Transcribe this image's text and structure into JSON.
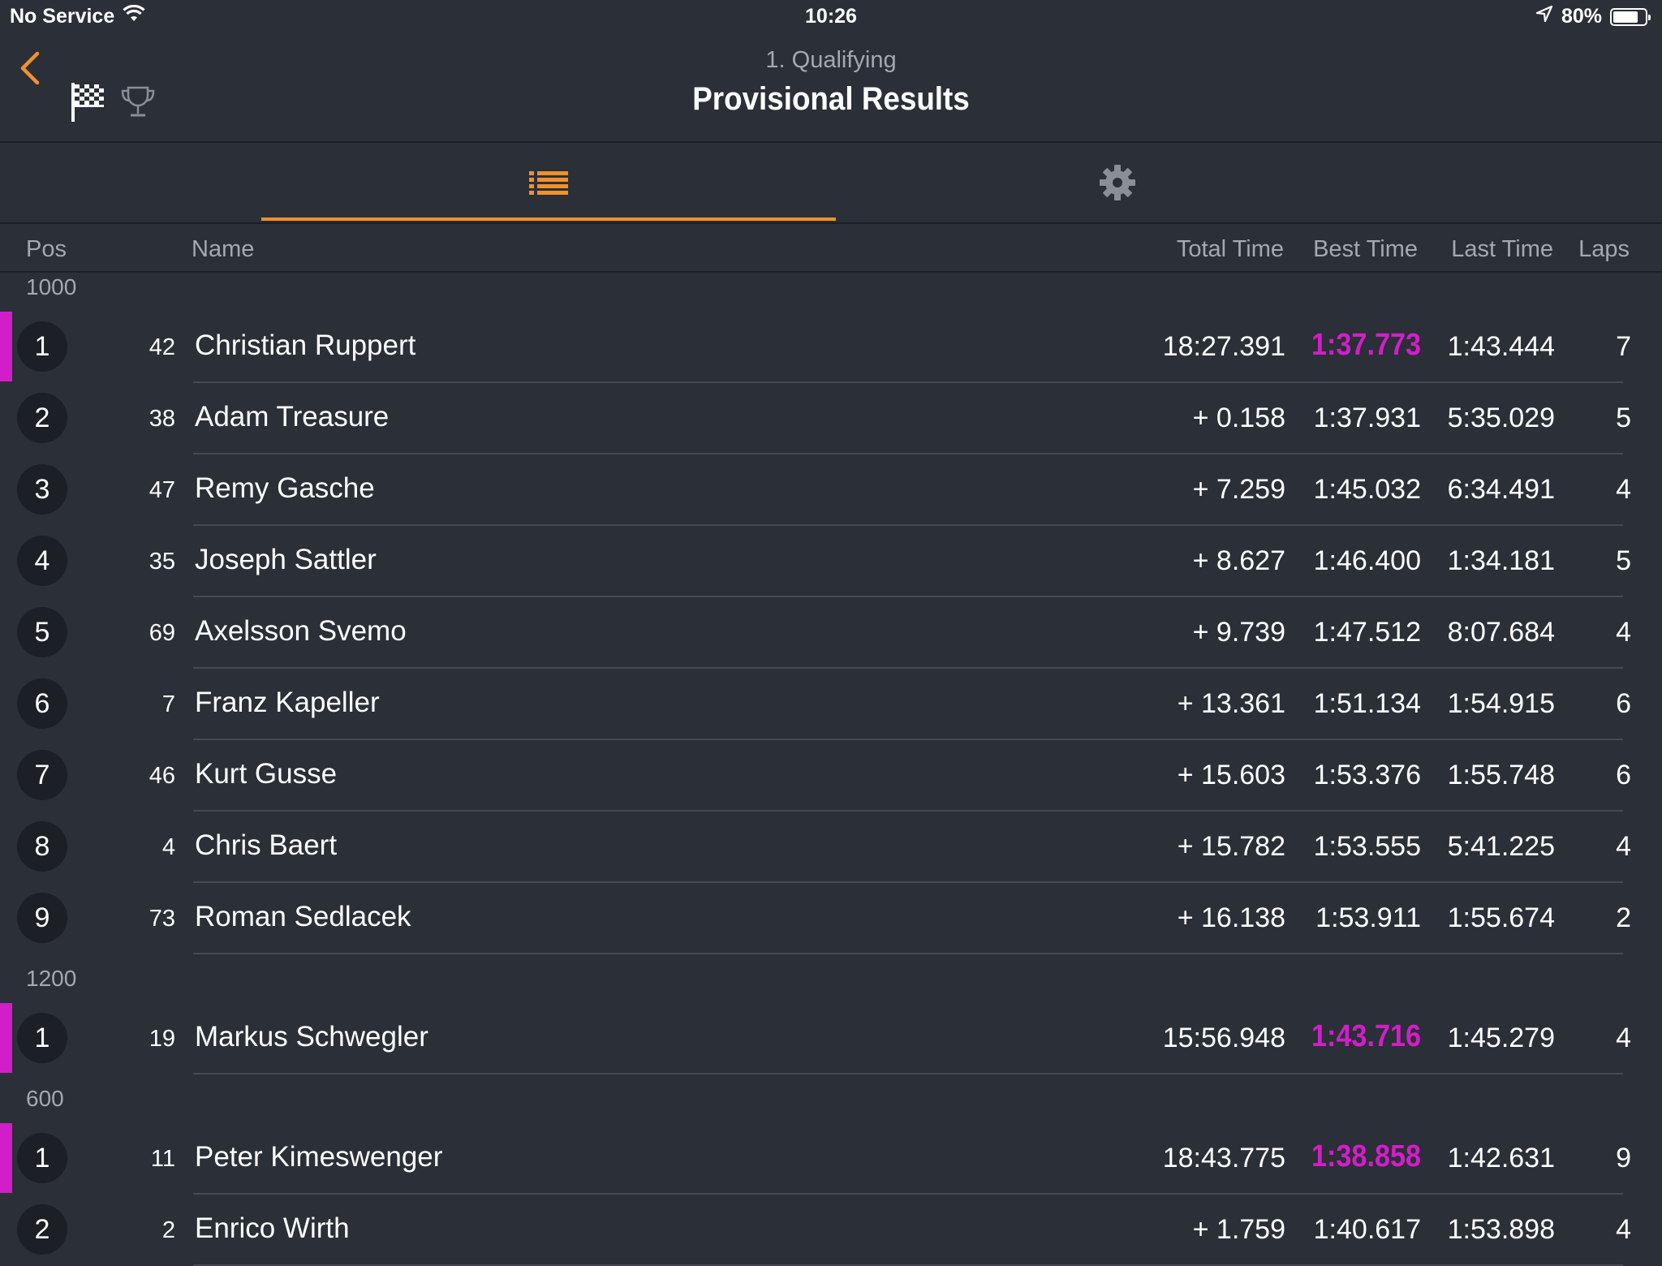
{
  "status_bar": {
    "carrier": "No Service",
    "time": "10:26",
    "battery": "80%",
    "battery_level": 0.8
  },
  "nav": {
    "subtitle": "1. Qualifying",
    "title": "Provisional Results"
  },
  "tabs": [
    {
      "icon": "list-icon",
      "selected": true
    },
    {
      "icon": "gear-icon",
      "selected": false
    }
  ],
  "columns": {
    "pos": "Pos",
    "name": "Name",
    "total": "Total Time",
    "best": "Best Time",
    "last": "Last Time",
    "laps": "Laps"
  },
  "colors": {
    "accent": "#f0912a",
    "fastest": "#d21ec9",
    "background": "#2b2f38"
  },
  "groups": [
    {
      "label": "1000",
      "rows": [
        {
          "pos": "1",
          "num": "42",
          "name": "Christian Ruppert",
          "total": "18:27.391",
          "best": "1:37.773",
          "last": "1:43.444",
          "laps": "7",
          "fastest": true
        },
        {
          "pos": "2",
          "num": "38",
          "name": "Adam Treasure",
          "total": "+ 0.158",
          "best": "1:37.931",
          "last": "5:35.029",
          "laps": "5"
        },
        {
          "pos": "3",
          "num": "47",
          "name": "Remy Gasche",
          "total": "+ 7.259",
          "best": "1:45.032",
          "last": "6:34.491",
          "laps": "4"
        },
        {
          "pos": "4",
          "num": "35",
          "name": "Joseph Sattler",
          "total": "+ 8.627",
          "best": "1:46.400",
          "last": "1:34.181",
          "laps": "5"
        },
        {
          "pos": "5",
          "num": "69",
          "name": "Axelsson Svemo",
          "total": "+ 9.739",
          "best": "1:47.512",
          "last": "8:07.684",
          "laps": "4"
        },
        {
          "pos": "6",
          "num": "7",
          "name": "Franz Kapeller",
          "total": "+ 13.361",
          "best": "1:51.134",
          "last": "1:54.915",
          "laps": "6"
        },
        {
          "pos": "7",
          "num": "46",
          "name": "Kurt Gusse",
          "total": "+ 15.603",
          "best": "1:53.376",
          "last": "1:55.748",
          "laps": "6"
        },
        {
          "pos": "8",
          "num": "4",
          "name": "Chris Baert",
          "total": "+ 15.782",
          "best": "1:53.555",
          "last": "5:41.225",
          "laps": "4"
        },
        {
          "pos": "9",
          "num": "73",
          "name": "Roman Sedlacek",
          "total": "+ 16.138",
          "best": "1:53.911",
          "last": "1:55.674",
          "laps": "2"
        }
      ]
    },
    {
      "label": "1200",
      "rows": [
        {
          "pos": "1",
          "num": "19",
          "name": "Markus Schwegler",
          "total": "15:56.948",
          "best": "1:43.716",
          "last": "1:45.279",
          "laps": "4",
          "fastest": true
        }
      ]
    },
    {
      "label": "600",
      "rows": [
        {
          "pos": "1",
          "num": "11",
          "name": "Peter Kimeswenger",
          "total": "18:43.775",
          "best": "1:38.858",
          "last": "1:42.631",
          "laps": "9",
          "fastest": true
        },
        {
          "pos": "2",
          "num": "2",
          "name": "Enrico Wirth",
          "total": "+ 1.759",
          "best": "1:40.617",
          "last": "1:53.898",
          "laps": "4"
        }
      ]
    }
  ]
}
